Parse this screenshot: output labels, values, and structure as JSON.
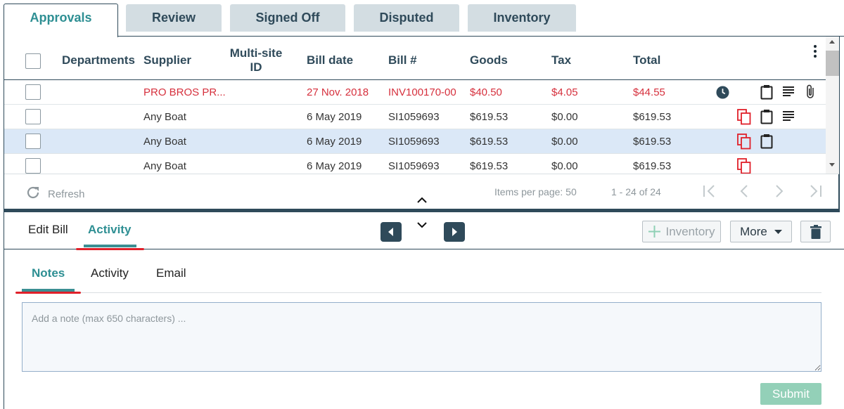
{
  "tabs": [
    {
      "label": "Approvals",
      "active": true
    },
    {
      "label": "Review"
    },
    {
      "label": "Signed Off"
    },
    {
      "label": "Disputed"
    },
    {
      "label": "Inventory"
    }
  ],
  "grid": {
    "columns": {
      "departments": "Departments",
      "supplier": "Supplier",
      "multisite_line1": "Multi-site",
      "multisite_line2": "ID",
      "bill_date": "Bill date",
      "bill_no": "Bill #",
      "goods": "Goods",
      "tax": "Tax",
      "total": "Total"
    },
    "rows": [
      {
        "supplier": "PRO BROS PR...",
        "bill_date": "27 Nov. 2018",
        "bill_no": "INV100170-00",
        "goods": "$40.50",
        "tax": "$4.05",
        "total": "$44.55",
        "status": "error",
        "icons": [
          "clock-icon",
          "clipboard-icon",
          "notes-icon",
          "attachment-icon"
        ]
      },
      {
        "supplier": "Any Boat",
        "bill_date": "6 May 2019",
        "bill_no": "SI1059693",
        "goods": "$619.53",
        "tax": "$0.00",
        "total": "$619.53",
        "icons": [
          "duplicate-icon",
          "clipboard-icon",
          "notes-icon"
        ]
      },
      {
        "supplier": "Any Boat",
        "bill_date": "6 May 2019",
        "bill_no": "SI1059693",
        "goods": "$619.53",
        "tax": "$0.00",
        "total": "$619.53",
        "selected": true,
        "icons": [
          "duplicate-icon",
          "clipboard-icon"
        ]
      },
      {
        "supplier": "Any Boat",
        "bill_date": "6 May 2019",
        "bill_no": "SI1059693",
        "goods": "$619.53",
        "tax": "$0.00",
        "total": "$619.53",
        "icons": [
          "duplicate-icon"
        ]
      }
    ]
  },
  "pager": {
    "refresh_label": "Refresh",
    "items_per_page_label": "Items per page: 50",
    "range": "1 - 24 of 24"
  },
  "detail": {
    "tabs": [
      {
        "label": "Edit Bill"
      },
      {
        "label": "Activity",
        "active": true
      }
    ],
    "inventory_button": "Inventory",
    "more_button": "More"
  },
  "notes": {
    "tabs": [
      {
        "label": "Notes",
        "active": true
      },
      {
        "label": "Activity"
      },
      {
        "label": "Email"
      }
    ],
    "placeholder": "Add a note (max 650 characters) ...",
    "submit_label": "Submit"
  },
  "colors": {
    "accent": "#2e8f93",
    "navy": "#2f4a5a",
    "error": "#d6303d",
    "selected_row": "#dbe8f7",
    "submit": "#93d0b8"
  }
}
